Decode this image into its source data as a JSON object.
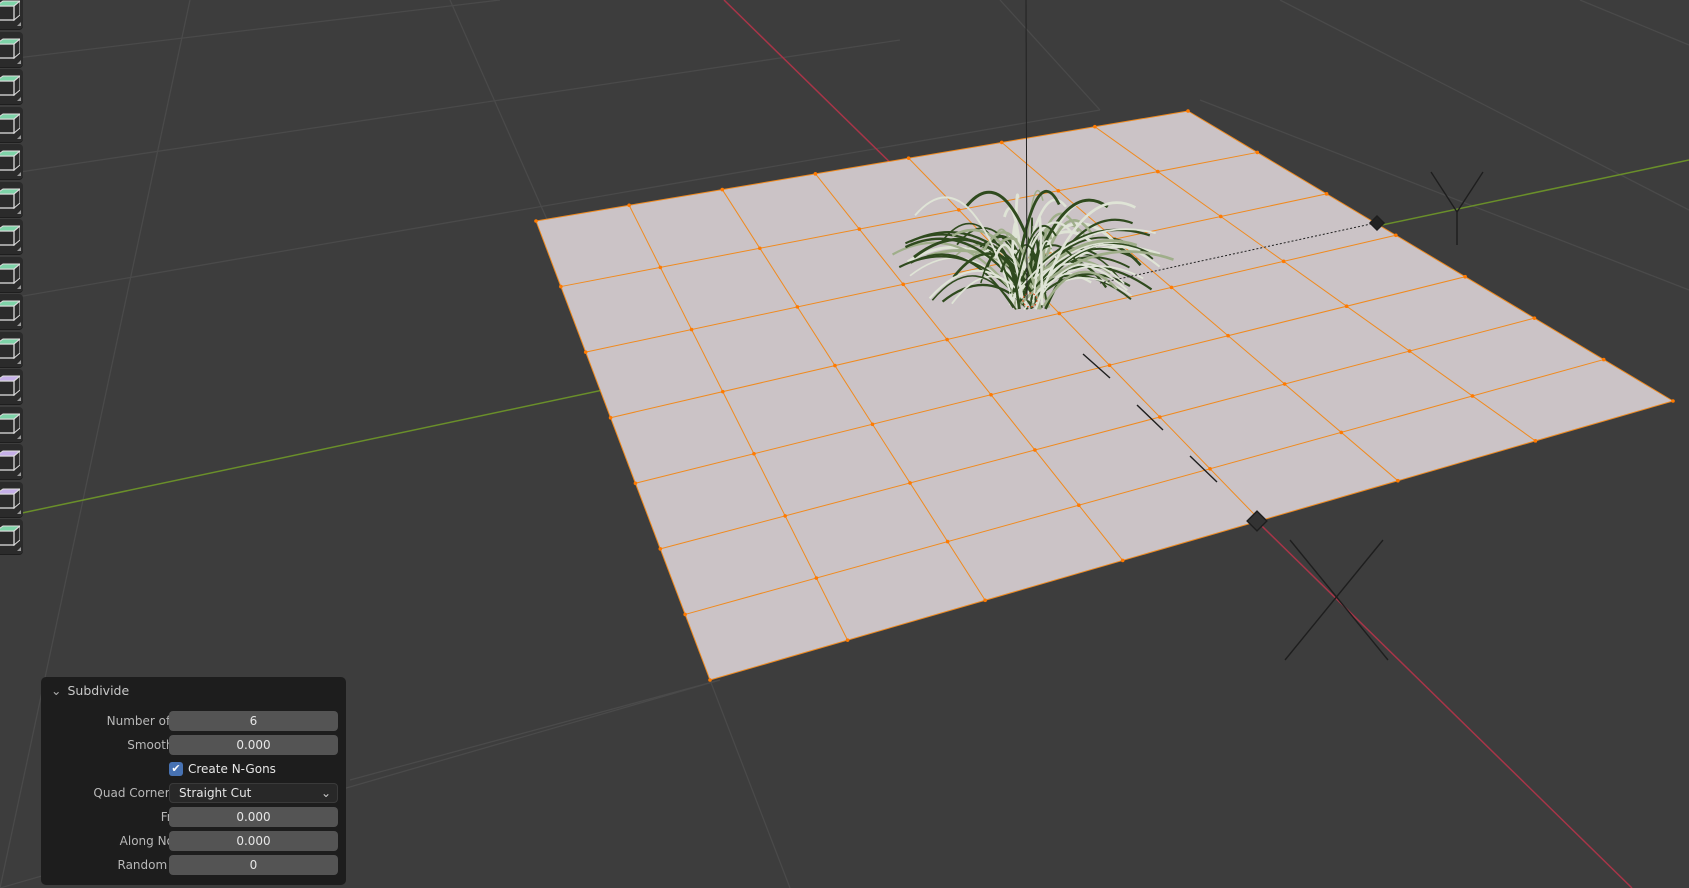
{
  "colors": {
    "background": "#3d3d3d",
    "x_axis": "#b0344a",
    "y_axis": "#6a8f2a",
    "mesh_face": "#cbc3c6",
    "mesh_edge": "#f08a1e",
    "panel": "#1d1d1d",
    "checkbox": "#4772b3"
  },
  "viewport": {
    "mesh": "plane",
    "subdivisions": 7,
    "selection": "all"
  },
  "toolbar": {
    "tools": [
      {
        "icon": "annotate-icon"
      },
      {
        "icon": "measure-icon"
      },
      {
        "icon": "add-cube-icon"
      },
      {
        "icon": "extrude-region-icon"
      },
      {
        "icon": "inset-faces-icon"
      },
      {
        "icon": "bevel-icon"
      },
      {
        "icon": "loop-cut-icon"
      },
      {
        "icon": "knife-icon"
      },
      {
        "icon": "poly-build-icon"
      },
      {
        "icon": "spin-icon"
      },
      {
        "icon": "smooth-icon"
      },
      {
        "icon": "edge-slide-icon"
      },
      {
        "icon": "shrink-fatten-icon"
      },
      {
        "icon": "shear-icon"
      },
      {
        "icon": "rip-region-icon"
      }
    ]
  },
  "operator_panel": {
    "title": "Subdivide",
    "number_of_cuts": {
      "label": "Number of Cuts",
      "value": "6"
    },
    "smoothness": {
      "label": "Smoothness",
      "value": "0.000"
    },
    "create_ngons": {
      "label": "Create N-Gons",
      "checked": true
    },
    "quad_corner_type": {
      "label": "Quad Corner Type",
      "value": "Straight Cut"
    },
    "fractal": {
      "label": "Fractal",
      "value": "0.000"
    },
    "along_normal": {
      "label": "Along Normal",
      "value": "0.000"
    },
    "random_seed": {
      "label": "Random Seed",
      "value": "0"
    }
  }
}
